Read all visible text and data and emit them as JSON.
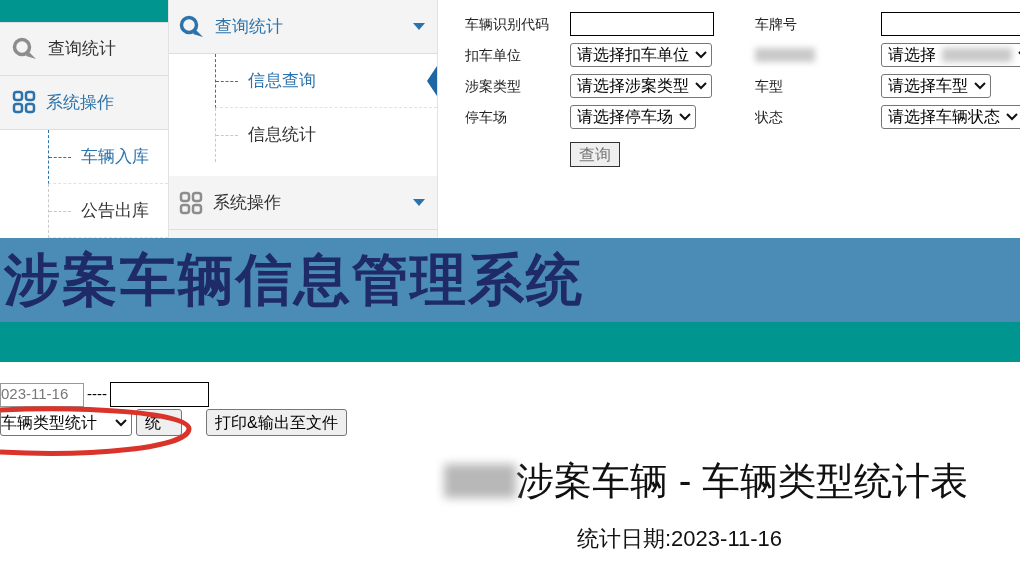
{
  "left_nav": {
    "groups": [
      {
        "label": "查询统计",
        "selected": false
      },
      {
        "label": "系统操作",
        "selected": true,
        "expanded": true,
        "children": [
          {
            "label": "车辆入库",
            "selected": true
          },
          {
            "label": "公告出库",
            "selected": false
          }
        ]
      }
    ]
  },
  "mid_nav": {
    "groups": [
      {
        "label": "查询统计",
        "selected": true,
        "expanded": true,
        "children": [
          {
            "label": "信息查询",
            "selected": true
          },
          {
            "label": "信息统计",
            "selected": false
          }
        ]
      },
      {
        "label": "系统操作",
        "selected": false
      }
    ]
  },
  "search_form": {
    "fields": [
      {
        "label": "车辆识别代码",
        "kind": "text"
      },
      {
        "label": "车牌号",
        "kind": "text"
      },
      {
        "label": "扣车单位",
        "kind": "select",
        "value": "请选择扣车单位"
      },
      {
        "label_redacted": true,
        "kind": "select",
        "value": "请选择",
        "value_redacted": true
      },
      {
        "label": "涉案类型",
        "kind": "select",
        "value": "请选择涉案类型"
      },
      {
        "label": "车型",
        "kind": "select",
        "value": "请选择车型"
      },
      {
        "label": "停车场",
        "kind": "select",
        "value": "请选择停车场"
      },
      {
        "label": "状态",
        "kind": "select",
        "value": "请选择车辆状态"
      }
    ],
    "button": "查询"
  },
  "banner": {
    "title": "涉案车辆信息管理系统"
  },
  "stats": {
    "start_date": "023-11-16",
    "separator": "----",
    "report_type": "车辆类型统计",
    "stat_button": "统",
    "print_button": "打印&输出至文件",
    "highlighted": true,
    "report_title": "涉案车辆 - 车辆类型统计表",
    "title_redacted": true,
    "report_date": "统计日期:2023-11-16"
  }
}
